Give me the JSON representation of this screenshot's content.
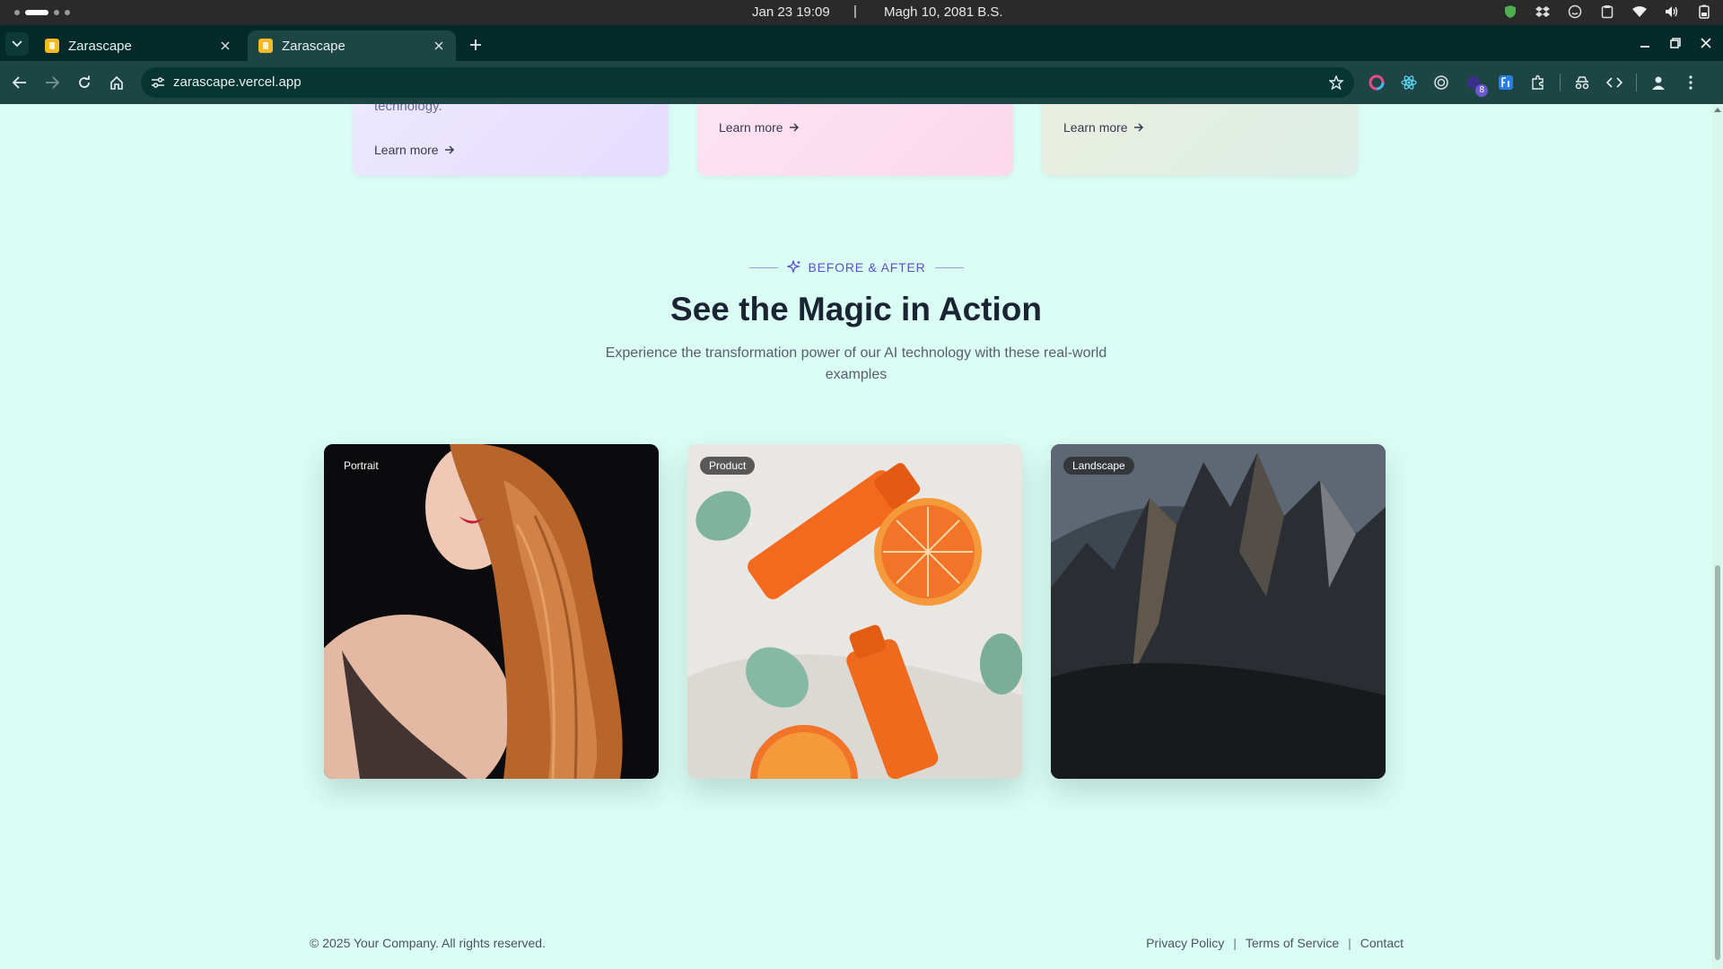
{
  "os_bar": {
    "clock": "Jan 23  19:09",
    "separator": "|",
    "nepali_date": "Magh 10, 2081 B.S."
  },
  "browser": {
    "tabs": [
      {
        "title": "Zarascape",
        "active": false
      },
      {
        "title": "Zarascape",
        "active": true
      }
    ],
    "url": "zarascape.vercel.app",
    "extension_badge": "8"
  },
  "features": {
    "card1_partial_text": "technology.",
    "learn_more_label": "Learn more"
  },
  "before_after": {
    "eyebrow": "BEFORE & AFTER",
    "title": "See the Magic in Action",
    "subtitle": "Experience the transformation power of our AI technology with these real-world examples",
    "items": [
      {
        "badge": "Portrait"
      },
      {
        "badge": "Product"
      },
      {
        "badge": "Landscape"
      }
    ]
  },
  "footer": {
    "copyright": "© 2025 Your Company. All rights reserved.",
    "links": [
      "Privacy Policy",
      "Terms of Service",
      "Contact"
    ],
    "separator": "|"
  },
  "colors": {
    "page_bg": "#dafdf4",
    "accent": "#5a4fd0",
    "heading": "#1b2433",
    "browser_frame": "#032a28",
    "toolbar": "#1c4543"
  }
}
